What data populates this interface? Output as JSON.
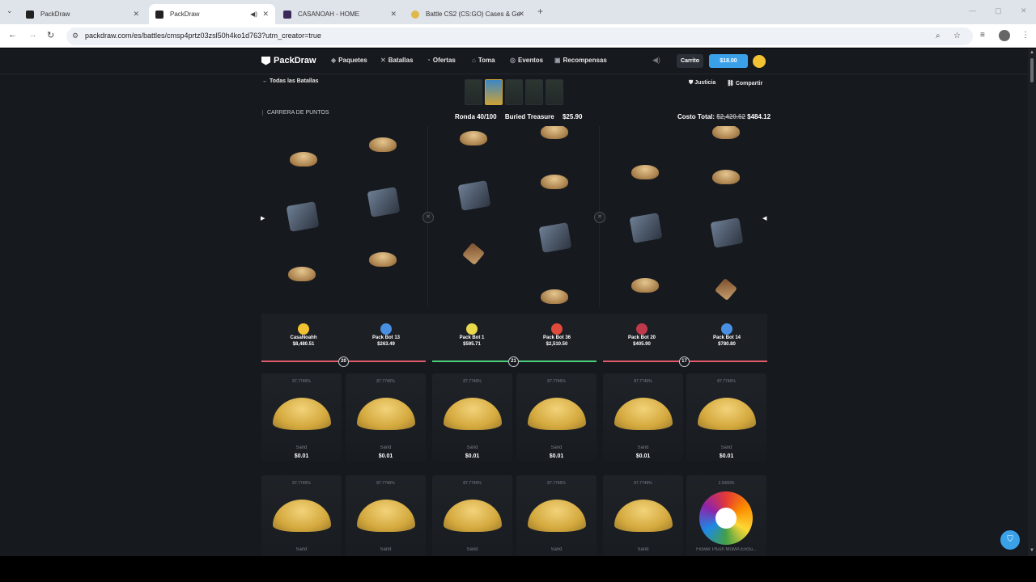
{
  "browser": {
    "tabs": [
      {
        "title": "PackDraw",
        "active": false
      },
      {
        "title": "PackDraw",
        "active": true
      },
      {
        "title": "CASANOAH - HOME",
        "active": false
      },
      {
        "title": "Battle CS2 (CS:GO) Cases & Ge",
        "active": false
      }
    ],
    "url": "packdraw.com/es/battles/cmsp4prtz03zsl50h4ko1d763?utm_creator=true"
  },
  "nav": {
    "brand": "PackDraw",
    "items": [
      "Paquetes",
      "Batallas",
      "Ofertas",
      "Toma",
      "Eventos",
      "Recompensas"
    ],
    "cart": "Carrito",
    "balance": "$18.00"
  },
  "battle": {
    "back_label": "Todas las Batallas",
    "fairness": "Justicia",
    "share": "Compartir",
    "mode": "CARRERA DE PUNTOS",
    "round": "Ronda 40/100",
    "case_name": "Buried Treasure",
    "case_price": "$25.90",
    "total_cost_label": "Costo Total:",
    "total_cost_old": "$2,420.62",
    "total_cost_new": "$484.12"
  },
  "players": [
    {
      "name": "CasaNoahh",
      "value": "$8,480.51",
      "color": "#f1c232"
    },
    {
      "name": "Pack Bot 13",
      "value": "$263.49",
      "color": "#4a90e2"
    },
    {
      "name": "Pack Bot 1",
      "value": "$595.71",
      "color": "#e8d84a"
    },
    {
      "name": "Pack Bot 36",
      "value": "$2,510.50",
      "color": "#e04a3a"
    },
    {
      "name": "Pack Bot 20",
      "value": "$405.90",
      "color": "#c0394b"
    },
    {
      "name": "Pack Bot 14",
      "value": "$780.80",
      "color": "#4a90e2"
    }
  ],
  "teams": [
    {
      "score": "20",
      "color": "#e05a6a"
    },
    {
      "score": "21",
      "color": "#4ccf7a"
    },
    {
      "score": "17",
      "color": "#e05a6a"
    }
  ],
  "drops_row1": [
    {
      "odds": "87.7746%",
      "name": "Sand",
      "price": "$0.01"
    },
    {
      "odds": "87.7746%",
      "name": "Sand",
      "price": "$0.01"
    },
    {
      "odds": "87.7746%",
      "name": "Sand",
      "price": "$0.01"
    },
    {
      "odds": "87.7746%",
      "name": "Sand",
      "price": "$0.01"
    },
    {
      "odds": "87.7746%",
      "name": "Sand",
      "price": "$0.01"
    },
    {
      "odds": "87.7746%",
      "name": "Sand",
      "price": "$0.01"
    }
  ],
  "drops_row2": [
    {
      "odds": "87.7746%",
      "name": "Sand"
    },
    {
      "odds": "87.7746%",
      "name": "Sand"
    },
    {
      "odds": "87.7746%",
      "name": "Sand"
    },
    {
      "odds": "87.7746%",
      "name": "Sand"
    },
    {
      "odds": "87.7746%",
      "name": "Sand"
    },
    {
      "odds": "2.5000%",
      "name": "Flower Plush MoMA Exclu..."
    }
  ]
}
